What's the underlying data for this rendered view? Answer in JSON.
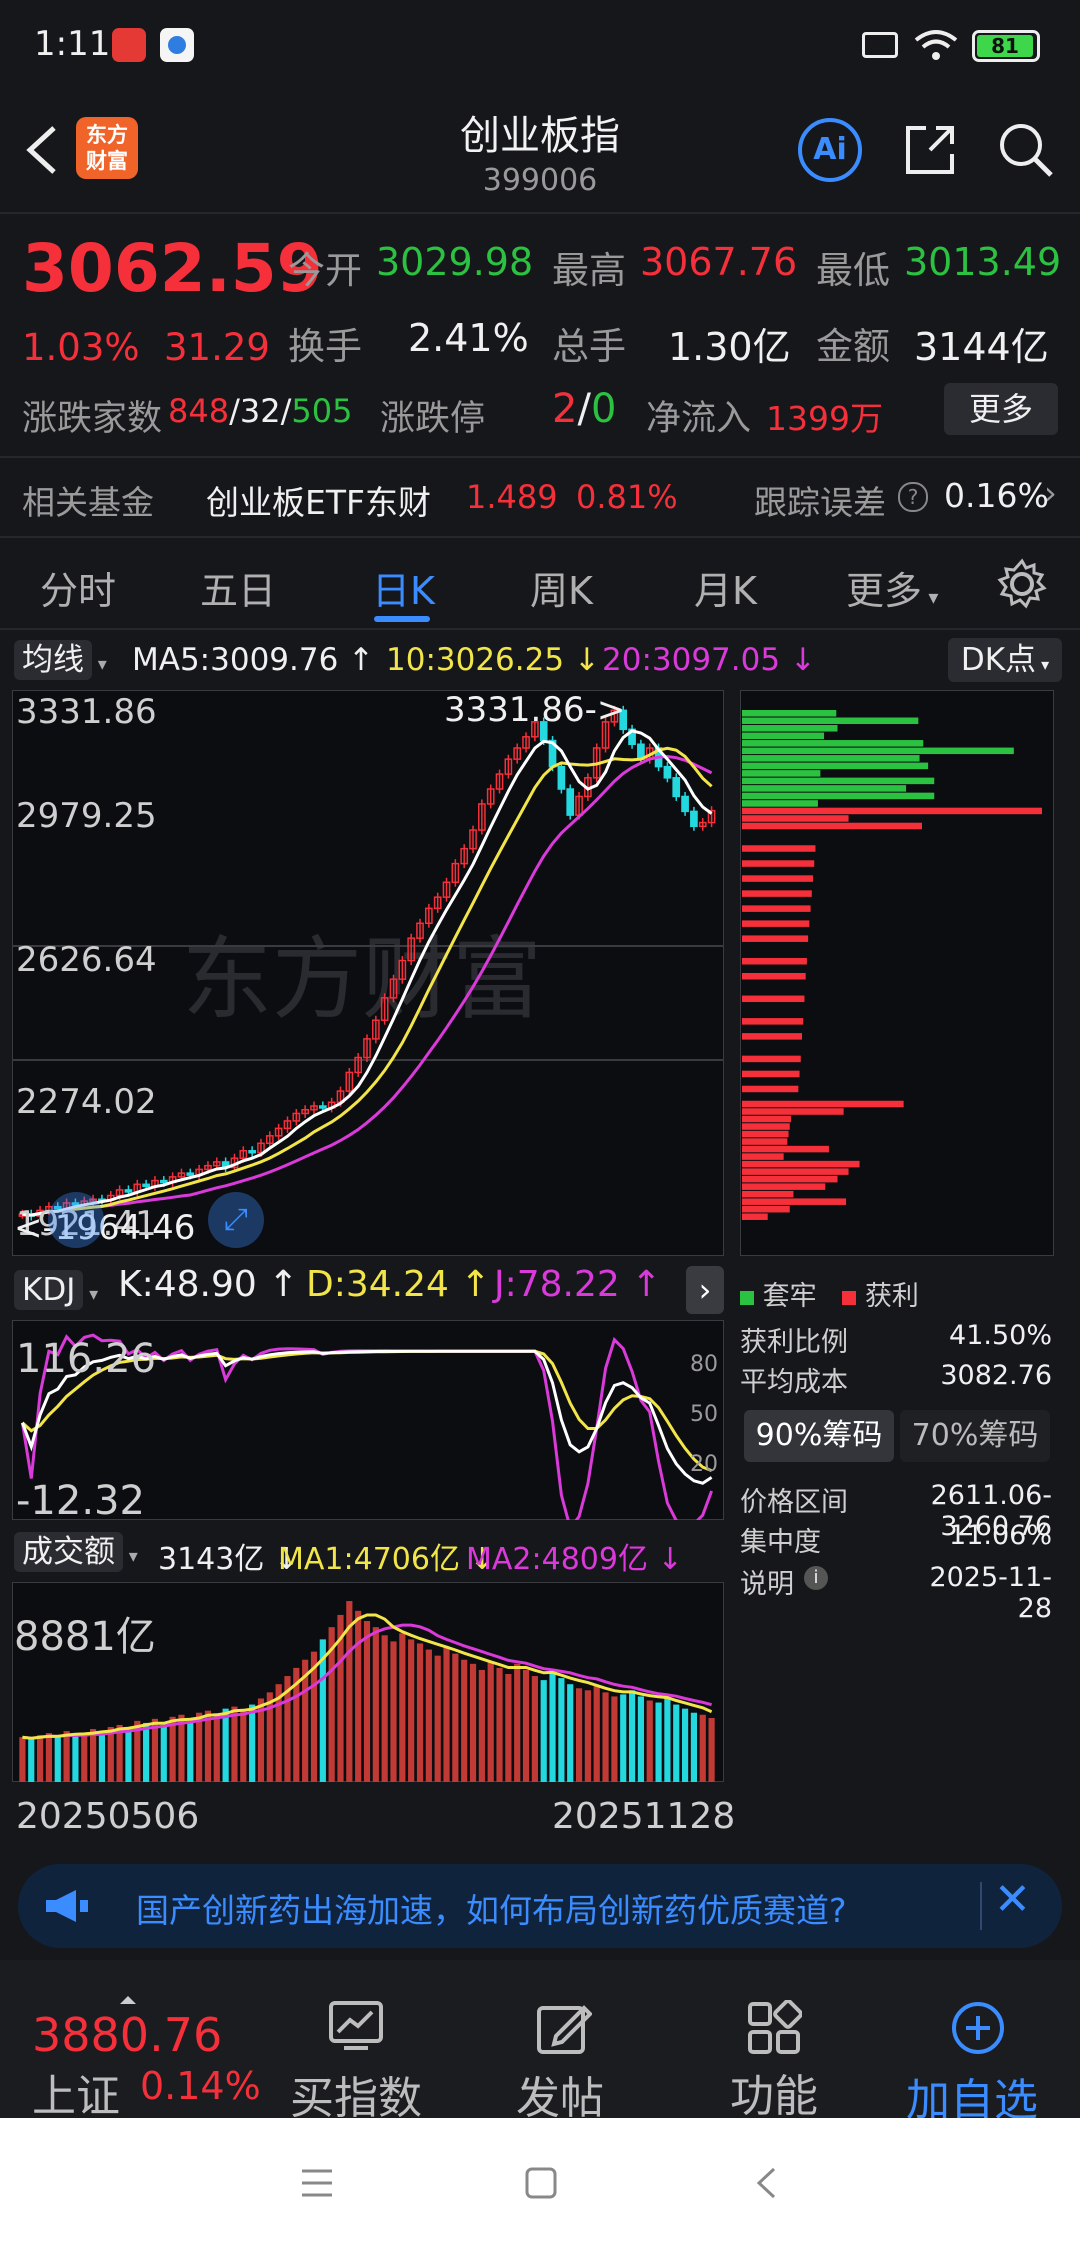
{
  "status_bar": {
    "time": "1:11",
    "battery": "81"
  },
  "header": {
    "title": "创业板指",
    "code": "399006",
    "logo_text_1": "东方",
    "logo_text_2": "财富",
    "ai_label": "Ai"
  },
  "quote": {
    "price": "3062.59",
    "change_pct": "1.03%",
    "change_amt": "31.29",
    "open_label": "今开",
    "open": "3029.98",
    "high_label": "最高",
    "high": "3067.76",
    "low_label": "最低",
    "low": "3013.49",
    "turnover_label": "换手",
    "turnover": "2.41%",
    "volume_label": "总手",
    "volume": "1.30亿",
    "amount_label": "金额",
    "amount": "3144亿",
    "breadth_label": "涨跌家数",
    "breadth_up": "848",
    "breadth_flat": "32",
    "breadth_down": "505",
    "limit_label": "涨跌停",
    "limit_up": "2",
    "limit_down": "0",
    "inflow_label": "净流入",
    "inflow": "1399万",
    "more_label": "更多"
  },
  "fund": {
    "label": "相关基金",
    "name": "创业板ETF东财",
    "price": "1.489",
    "pct": "0.81%",
    "track_label": "跟踪误差",
    "track_value": "0.16%"
  },
  "tabs": [
    "分时",
    "五日",
    "日K",
    "周K",
    "月K",
    "更多"
  ],
  "active_tab": "日K",
  "ma_bar": {
    "label": "均线",
    "ma5": "MA5:3009.76",
    "ma10": "10:3026.25",
    "ma20": "20:3097.05",
    "dk_label": "DK点"
  },
  "price_axis": [
    "3331.86",
    "2979.25",
    "2626.64",
    "2274.02",
    "1921.41"
  ],
  "annotations": {
    "high_mark": "3331.86->",
    "low_mark": "<-1964.46"
  },
  "watermark": "东方财富",
  "kdj": {
    "label": "KDJ",
    "k": "K:48.90",
    "d": "D:34.24",
    "j": "J:78.22",
    "top": "116.26",
    "bottom": "-12.32",
    "levels": [
      "80",
      "50",
      "20"
    ]
  },
  "vol": {
    "label": "成交额",
    "value": "3143亿",
    "ma1": "MA1:4706亿",
    "ma2": "MA2:4809亿",
    "top": "8881亿",
    "date_start": "20250506",
    "date_end": "20251128"
  },
  "chip_panel": {
    "legend_trapped": "套牢",
    "legend_profit": "获利",
    "rows": [
      {
        "label": "获利比例",
        "value": "41.50%"
      },
      {
        "label": "平均成本",
        "value": "3082.76"
      }
    ],
    "btn_90": "90%筹码",
    "btn_70": "70%筹码",
    "rows2": [
      {
        "label": "价格区间",
        "value": "2611.06-3260.76"
      },
      {
        "label": "集中度",
        "value": "11.06%"
      },
      {
        "label": "说明",
        "value": "2025-11-28"
      }
    ]
  },
  "banner": {
    "text": "国产创新药出海加速，如何布局创新药优质赛道?"
  },
  "bottom": {
    "index_price": "3880.76",
    "index_name": "上证",
    "index_pct": "0.14%",
    "btn1": "买指数",
    "btn2": "发帖",
    "btn3": "功能",
    "btn4": "加自选"
  },
  "chart_data": {
    "type": "candlestick",
    "range": {
      "start": "20250506",
      "end": "20251128"
    },
    "y_axis": [
      1921.41,
      3331.86
    ],
    "ma5_last": 3009.76,
    "ma10_last": 3026.25,
    "ma20_last": 3097.05,
    "close_series": [
      1980,
      1975,
      1990,
      2000,
      1995,
      2010,
      2005,
      2015,
      2020,
      2018,
      2030,
      2045,
      2040,
      2060,
      2055,
      2070,
      2065,
      2080,
      2090,
      2085,
      2100,
      2110,
      2120,
      2105,
      2130,
      2150,
      2145,
      2170,
      2190,
      2210,
      2230,
      2250,
      2260,
      2270,
      2265,
      2280,
      2310,
      2360,
      2400,
      2450,
      2500,
      2560,
      2610,
      2660,
      2720,
      2760,
      2800,
      2830,
      2870,
      2920,
      2960,
      3010,
      3080,
      3120,
      3160,
      3200,
      3230,
      3260,
      3300,
      3250,
      3180,
      3120,
      3050,
      3100,
      3150,
      3230,
      3300,
      3331,
      3280,
      3240,
      3200,
      3230,
      3180,
      3150,
      3100,
      3060,
      3020,
      3030,
      3062
    ],
    "volume_series": [
      2200,
      2100,
      2300,
      2400,
      2200,
      2500,
      2300,
      2400,
      2600,
      2500,
      2700,
      2800,
      2600,
      3000,
      2900,
      3100,
      2800,
      3200,
      3300,
      3000,
      3400,
      3500,
      3300,
      3600,
      3700,
      3500,
      3800,
      4100,
      4400,
      4800,
      5200,
      5600,
      6000,
      6400,
      7000,
      7600,
      8200,
      8881,
      8400,
      7900,
      7600,
      7200,
      6900,
      7300,
      7000,
      6800,
      6500,
      6200,
      6600,
      6300,
      6000,
      5800,
      5500,
      5900,
      5600,
      5300,
      5800,
      5500,
      5200,
      5000,
      5400,
      5100,
      4800,
      4600,
      4500,
      4700,
      4400,
      4200,
      4300,
      4500,
      4200,
      4000,
      3900,
      4100,
      3800,
      3600,
      3400,
      3300,
      3143
    ],
    "kdj_k_last": 48.9,
    "kdj_d_last": 34.24,
    "kdj_j_last": 78.22
  }
}
